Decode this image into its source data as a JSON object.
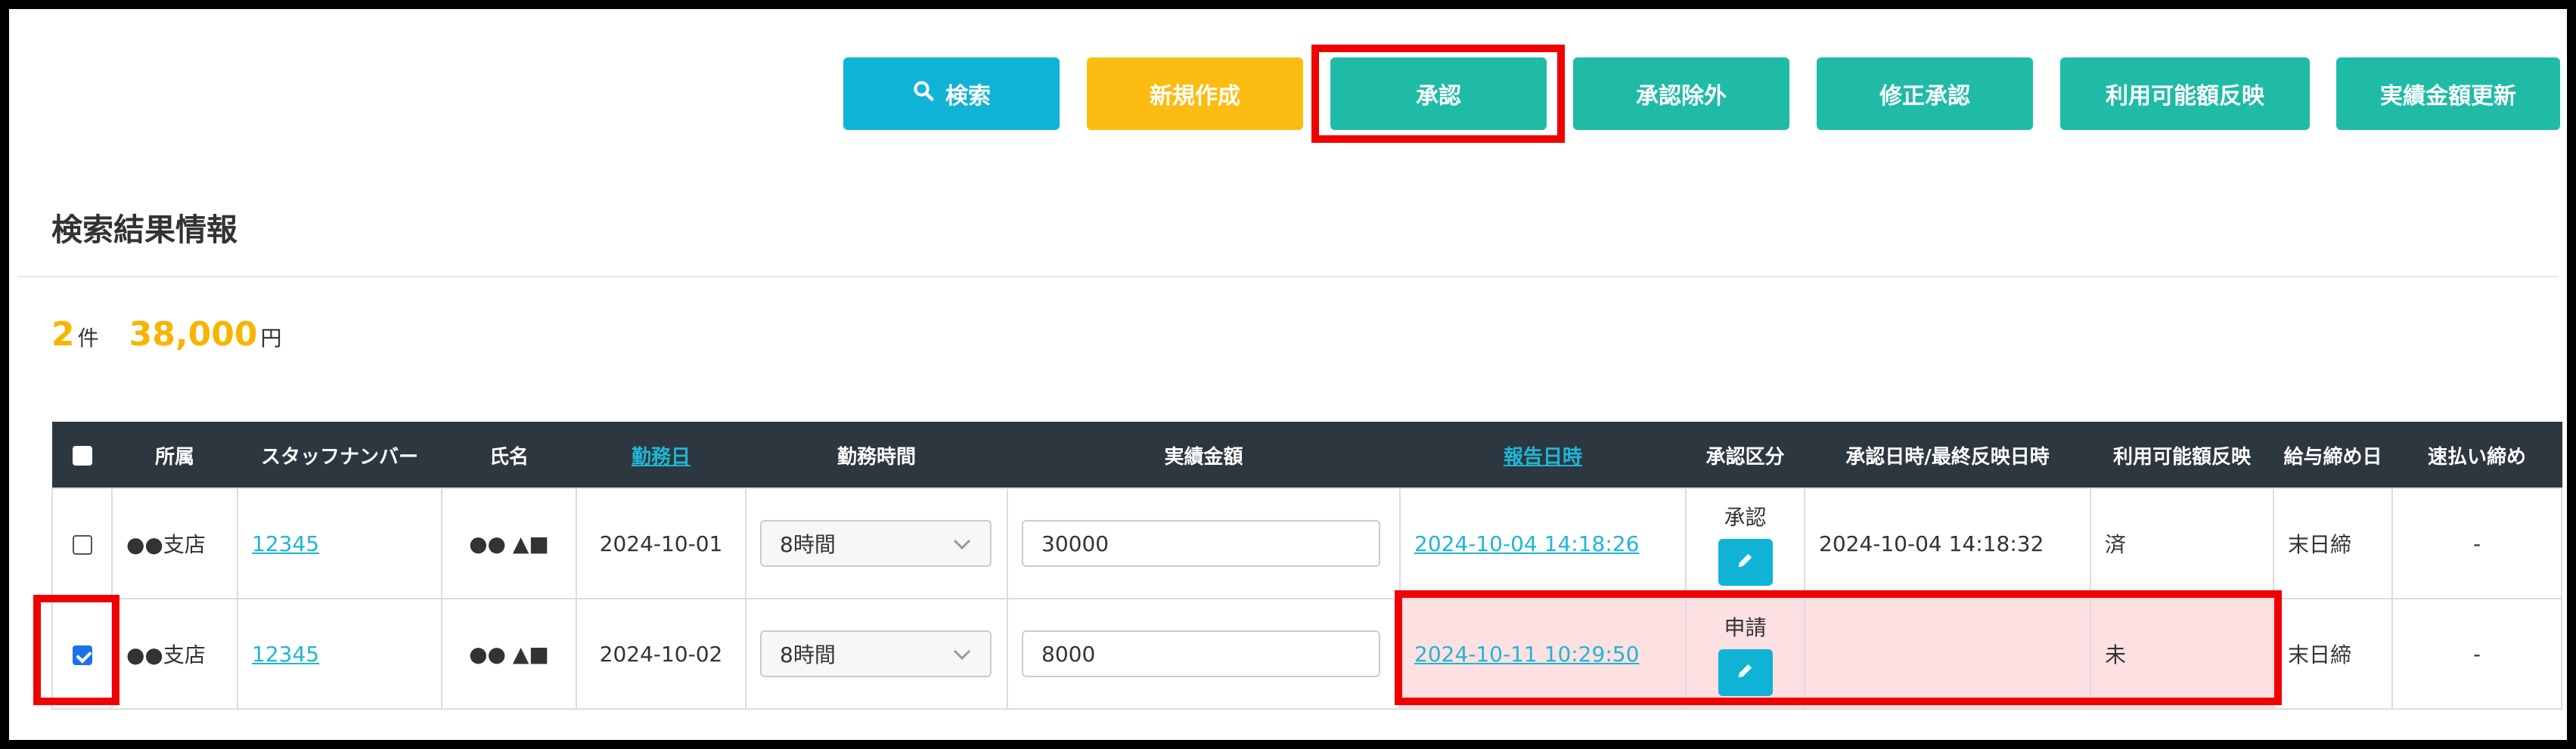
{
  "toolbar": {
    "search_label": "検索",
    "new_label": "新規作成",
    "approve_label": "承認",
    "exclude_label": "承認除外",
    "fix_approve_label": "修正承認",
    "reflect_label": "利用可能額反映",
    "update_label": "実績金額更新"
  },
  "section": {
    "title": "検索結果情報"
  },
  "summary": {
    "count": "2",
    "count_unit": "件",
    "amount": "38,000",
    "amount_unit": "円"
  },
  "table": {
    "headers": {
      "dept": "所属",
      "staff_no": "スタッフナンバー",
      "name": "氏名",
      "work_date": "勤務日",
      "work_time": "勤務時間",
      "actual_amount": "実績金額",
      "report_datetime": "報告日時",
      "approval_class": "承認区分",
      "approval_datetime": "承認日時/最終反映日時",
      "available_reflect": "利用可能額反映",
      "pay_cutoff": "給与締め日",
      "quick_cutoff": "速払い締め"
    },
    "rows": [
      {
        "checked": false,
        "dept": "●●支店",
        "staff_no": "12345",
        "name": "●● ▲■",
        "work_date": "2024-10-01",
        "work_time": "8時間",
        "actual_amount": "30000",
        "report_datetime": "2024-10-04 14:18:26",
        "approval_class": "承認",
        "approval_datetime": "2024-10-04 14:18:32",
        "available_reflect": "済",
        "pay_cutoff": "末日締",
        "quick_cutoff": "-"
      },
      {
        "checked": true,
        "dept": "●●支店",
        "staff_no": "12345",
        "name": "●● ▲■",
        "work_date": "2024-10-02",
        "work_time": "8時間",
        "actual_amount": "8000",
        "report_datetime": "2024-10-11 10:29:50",
        "approval_class": "申請",
        "approval_datetime": "",
        "available_reflect": "未",
        "pay_cutoff": "末日締",
        "quick_cutoff": "-"
      }
    ]
  },
  "colors": {
    "search_button": "#10b3d6",
    "new_button": "#fdbc12",
    "action_button": "#1fbba6",
    "header_bg": "#2c3740",
    "highlight": "#f00000",
    "pending_row_bg": "#fde0e1",
    "accent_number": "#f7b500"
  },
  "icons": {
    "search": "search-icon",
    "edit": "pencil-icon",
    "dropdown": "chevron-down-icon"
  }
}
